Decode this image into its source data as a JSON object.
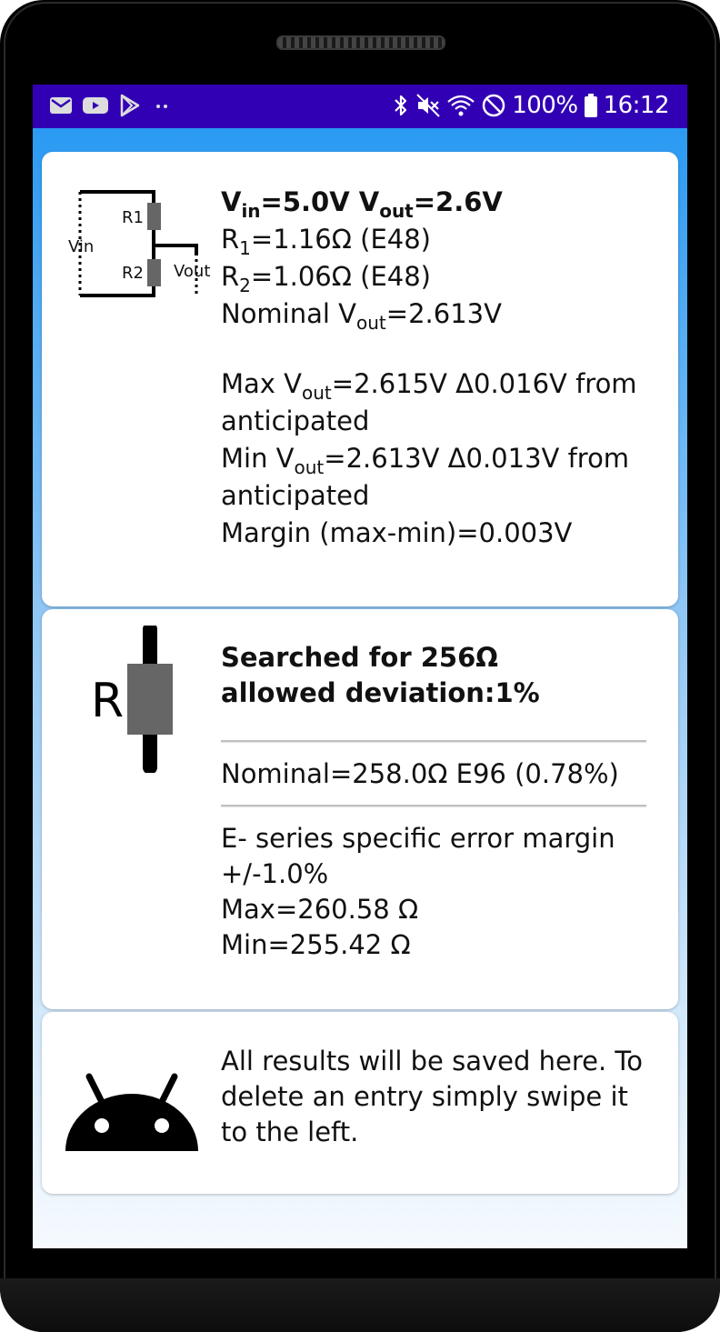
{
  "status_bar": {
    "battery_percent": "100%",
    "time": "16:12",
    "icons": [
      "gmail-icon",
      "youtube-icon",
      "play-store-icon",
      "more-dots-icon",
      "bluetooth-icon",
      "mute-icon",
      "wifi-icon",
      "dnd-icon",
      "battery-icon"
    ]
  },
  "cards": {
    "divider": {
      "diagram": {
        "r1": "R1",
        "r2": "R2",
        "vin": "Vin",
        "vout": "Vout"
      },
      "title_v": "V",
      "title_in_sub": "in",
      "title_mid": "=5.0V V",
      "title_out_sub": "out",
      "title_end": "=2.6V",
      "r1_prefix": "R",
      "r1_sub": "1",
      "r1_value": "=1.16Ω (E48)",
      "r2_prefix": "R",
      "r2_sub": "2",
      "r2_value": "=1.06Ω (E48)",
      "nominal_prefix": "Nominal V",
      "nominal_sub": "out",
      "nominal_value": "=2.613V",
      "max_prefix": "Max V",
      "max_sub": "out",
      "max_value": "=2.615V Δ0.016V from anticipated",
      "min_prefix": "Min V",
      "min_sub": "out",
      "min_value": "=2.613V Δ0.013V from anticipated",
      "margin": "Margin (max-min)=0.003V"
    },
    "resistor": {
      "icon_letter": "R",
      "searched": "Searched for 256Ω",
      "deviation": "allowed deviation:1%",
      "nominal": "Nominal=258.0Ω E96 (0.78%)",
      "error_margin_line1": "E- series specific error margin",
      "error_margin_line2": "+/-1.0%",
      "max": "Max=260.58 Ω",
      "min": "Min=255.42 Ω"
    },
    "info": {
      "message": "All results will be saved here. To delete an entry simply swipe it to the left."
    }
  },
  "colors": {
    "status_bar": "#3200b4",
    "background_top": "#2196f3",
    "card": "#ffffff",
    "resistor_body": "#666666"
  }
}
